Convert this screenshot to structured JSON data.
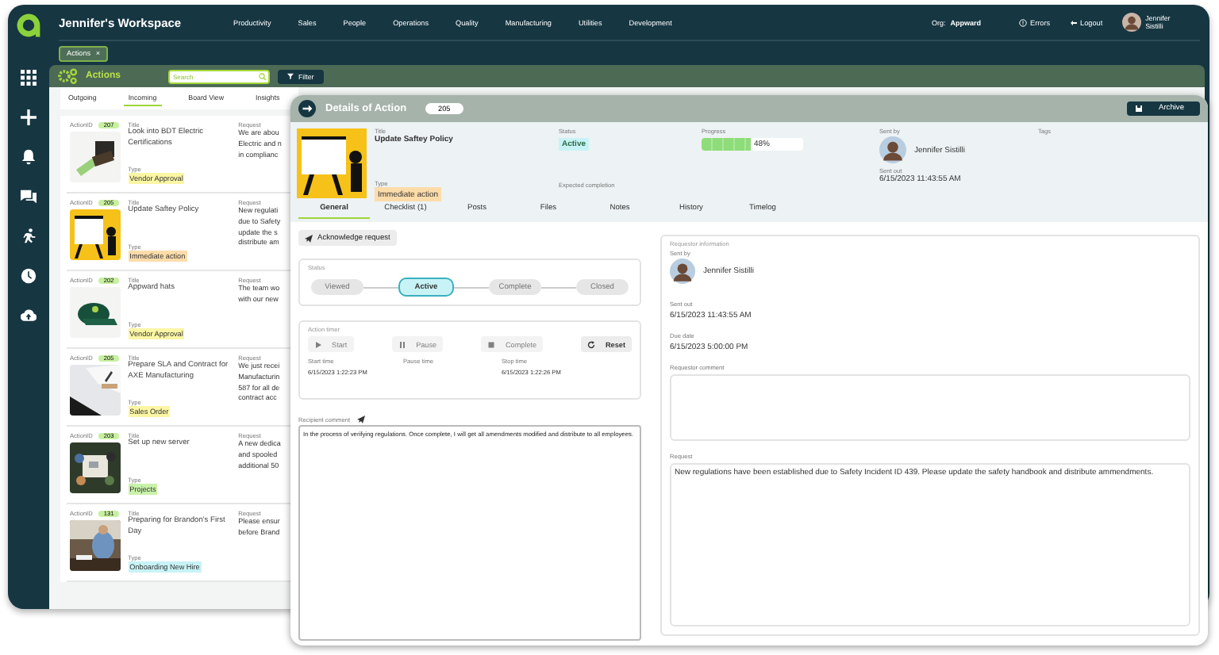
{
  "top_bar": {
    "workspace": "Jennifer's Workspace",
    "nav": [
      "Productivity",
      "Sales",
      "People",
      "Operations",
      "Quality",
      "Manufacturing",
      "Utilities",
      "Development"
    ],
    "org_label": "Org:",
    "org": "Appward",
    "errors": "Errors",
    "logout": "Logout",
    "user": "Jennifer Sistilli"
  },
  "open_tabs": [
    {
      "label": "Actions",
      "close": "×",
      "selected": true
    }
  ],
  "actions_bar": {
    "title": "Actions",
    "search": {
      "placeholder": "Search"
    },
    "filter": "Filter"
  },
  "list_tabs": [
    {
      "label": "Outgoing",
      "selected": false
    },
    {
      "label": "Incoming",
      "selected": true
    },
    {
      "label": "Board View",
      "selected": false
    },
    {
      "label": "Insights",
      "selected": false
    }
  ],
  "cards": [
    {
      "id_label": "ActionID",
      "id": "207",
      "title_label": "Title",
      "title": "Look into BDT Electric Certifications",
      "type_label": "Type",
      "type": "Vendor Approval",
      "color": "#fbf6a4",
      "request_label": "Request",
      "request": "We are abou\nElectric and n\nin complianc"
    },
    {
      "id_label": "ActionID",
      "id": "205",
      "title_label": "Title",
      "title": "Update Saftey Policy",
      "type_label": "Type",
      "type": "Immediate action",
      "color": "#fddcaa",
      "request_label": "Request",
      "request": "New regulati\ndue to Safety\nupdate the s\ndistribute am"
    },
    {
      "id_label": "ActionID",
      "id": "202",
      "title_label": "Title",
      "title": "Appward hats",
      "type_label": "Type",
      "type": "Vendor Approval",
      "color": "#fbf6a4",
      "request_label": "Request",
      "request": "The team wo\nwith our new"
    },
    {
      "id_label": "ActionID",
      "id": "205",
      "title_label": "Title",
      "title": "Prepare SLA and Contract for AXE Manufacturing",
      "type_label": "Type",
      "type": "Sales Order",
      "color": "#fbf6a4",
      "request_label": "Request",
      "request": "We just recei\nManufacturin\n587 for all de\ncontract acc"
    },
    {
      "id_label": "ActionID",
      "id": "203",
      "title_label": "Title",
      "title": "Set up new server",
      "type_label": "Type",
      "type": "Projects",
      "color": "#c9f2a9",
      "request_label": "Request",
      "request": "A new dedica\nand spooled\nadditional 50"
    },
    {
      "id_label": "ActionID",
      "id": "131",
      "title_label": "Title",
      "title": "Preparing for Brandon's First Day",
      "type_label": "Type",
      "type": "Onboarding New Hire",
      "color": "#c8f3f6",
      "request_label": "Request",
      "request": "Please ensur\nbefore Brand"
    }
  ],
  "details": {
    "title": "Details of Action",
    "id": "205",
    "archive": "Archive",
    "info": {
      "title_label": "Title",
      "title": "Update Saftey Policy",
      "type_label": "Type",
      "type": "Immediate action",
      "status_label": "Status",
      "status": "Active",
      "expected_label": "Expected completion",
      "progress_label": "Progress",
      "level": 0.48,
      "progress_reading": "48%",
      "sent_by_label": "Sent by",
      "sent_by": "Jennifer Sistilli",
      "sent_out_label": "Sent out",
      "sent_out": "6/15/2023 11:43:55 AM",
      "tags_label": "Tags"
    },
    "tabs": [
      {
        "label": "General",
        "selected": true
      },
      {
        "label": "Checklist (1)",
        "selected": false
      },
      {
        "label": "Posts",
        "selected": false
      },
      {
        "label": "Files",
        "selected": false
      },
      {
        "label": "Notes",
        "selected": false
      },
      {
        "label": "History",
        "selected": false
      },
      {
        "label": "Timelog",
        "selected": false
      }
    ],
    "acknowledge": "Acknowledge request",
    "status_legend": "Status",
    "steps": [
      {
        "label": "Viewed",
        "selected": false
      },
      {
        "label": "Active",
        "selected": true
      },
      {
        "label": "Complete",
        "selected": false
      },
      {
        "label": "Closed",
        "selected": false
      }
    ],
    "timer_legend": "Action timer",
    "timer_buttons": [
      {
        "kind": "play",
        "label": "Start",
        "disabled": true
      },
      {
        "kind": "pause",
        "label": "Pause",
        "disabled": true
      },
      {
        "kind": "stop",
        "label": "Complete",
        "disabled": true
      },
      {
        "kind": "reset",
        "label": "Reset",
        "disabled": false
      }
    ],
    "times": [
      {
        "label": "Start time",
        "value": "6/15/2023 1:22:23 PM"
      },
      {
        "label": "Pause time"
      },
      {
        "label": "Stop time",
        "value": "6/15/2023 1:22:26 PM"
      }
    ],
    "recipient_comment_label": "Recipient comment",
    "recipient_comment": "In the process of verifying regulations. Once complete, I will get all amendments modified and distribute to all employees.",
    "requestor": {
      "legend": "Requestor information",
      "sent_by_label": "Sent by",
      "sent_by": "Jennifer Sistilli",
      "sent_out_label": "Sent out",
      "sent_out": "6/15/2023 11:43:55 AM",
      "due_label": "Due date",
      "due": "6/15/2023 5:00:00 PM",
      "comment_label": "Requestor comment",
      "request_label": "Request",
      "request": "New regulations have been established due to Safety Incident ID 439. Please update the safety handbook and distribute ammendments."
    }
  }
}
